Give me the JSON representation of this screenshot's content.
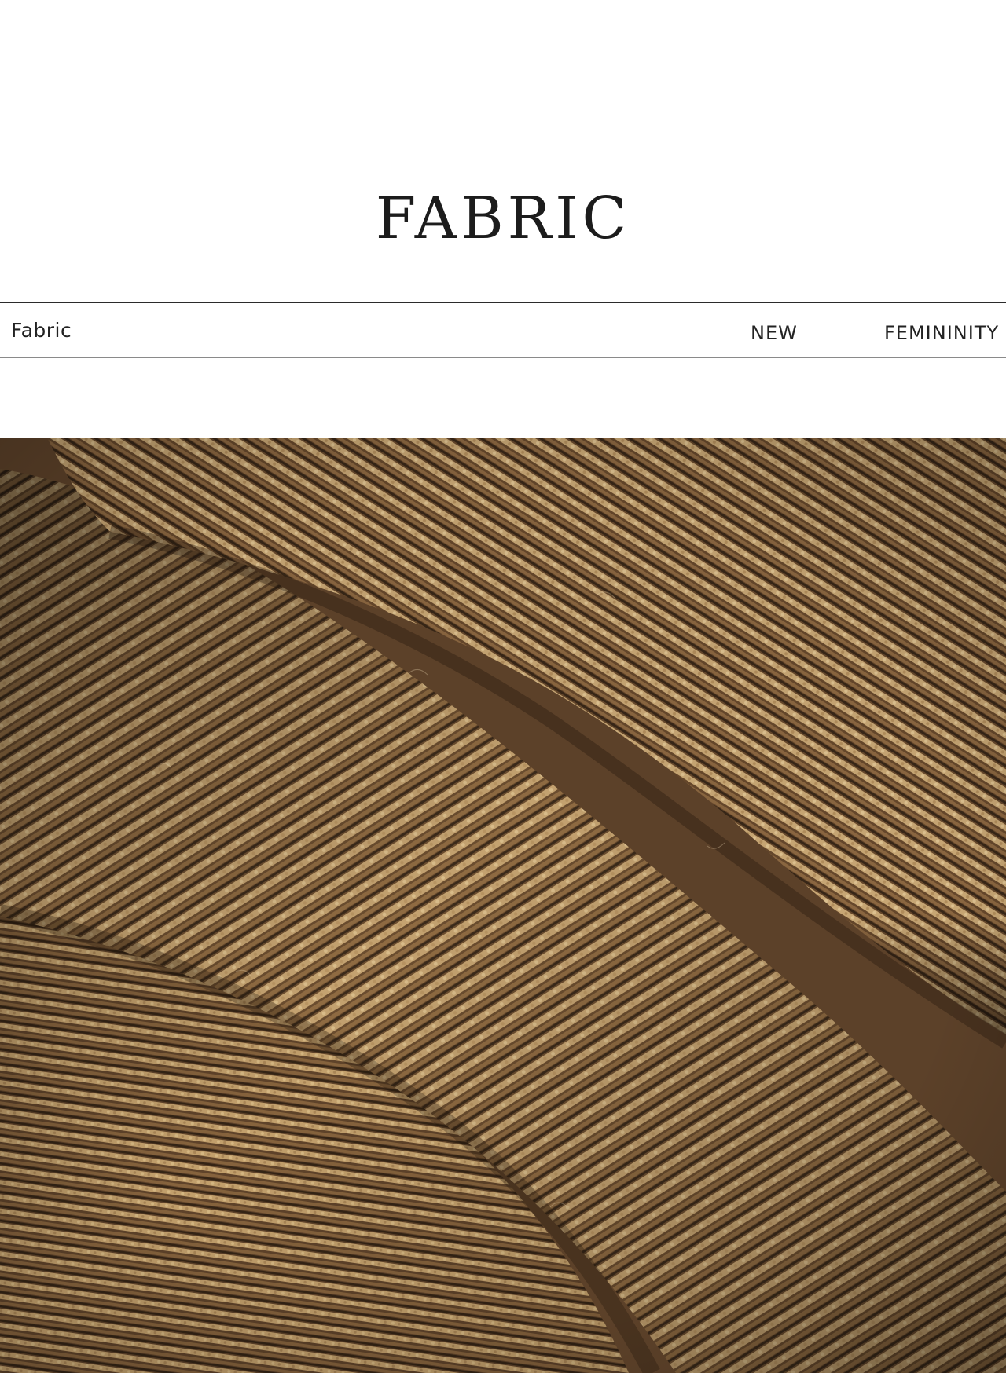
{
  "header": {
    "title": "FABRIC"
  },
  "label_bar": {
    "left_label": "Fabric",
    "tag_new": "NEW",
    "tag_femininity": "FEMININITY"
  },
  "photo": {
    "subject": "brown-tweed-wool-fabric",
    "colors": {
      "base": "#6e5234",
      "light": "#c9aa78",
      "dark": "#3a2818",
      "mid": "#8d6a43"
    }
  }
}
